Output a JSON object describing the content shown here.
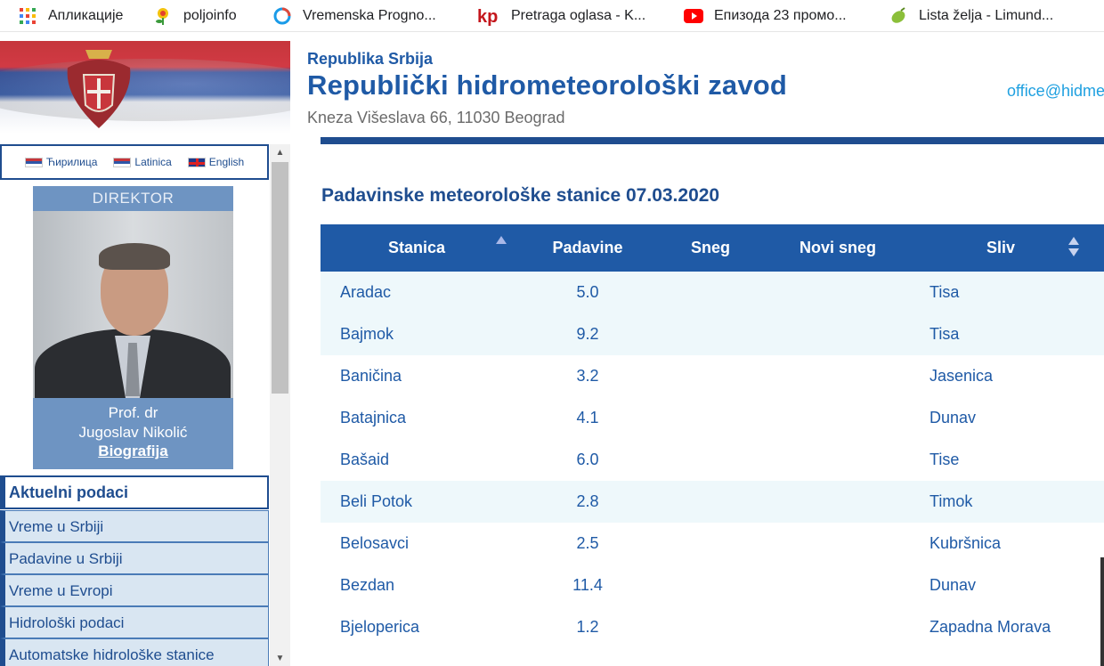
{
  "bookmarks": [
    {
      "label": "Апликације",
      "icon": "apps-grid-icon"
    },
    {
      "label": "poljoinfo",
      "icon": "flower-icon"
    },
    {
      "label": "Vremenska Progno...",
      "icon": "ring-icon"
    },
    {
      "label": "Pretraga oglasa - K...",
      "icon": "kp-logo-icon"
    },
    {
      "label": "Епизода 23 промо...",
      "icon": "youtube-icon"
    },
    {
      "label": "Lista želja - Limund...",
      "icon": "leaf-icon"
    }
  ],
  "header": {
    "org_small": "Republika Srbija",
    "org_big": "Republički hidrometeorološki zavod",
    "address": "Kneza Višeslava 66, 11030 Beograd",
    "email": "office@hidmet.gov.rs"
  },
  "sidebar": {
    "languages": [
      "Ћирилица",
      "Latinica",
      "English"
    ],
    "director_title": "DIREKTOR",
    "director_name_1": "Prof. dr",
    "director_name_2": "Jugoslav Nikolić",
    "director_link": "Biografija",
    "menu_head": "Aktuelni podaci",
    "menu_items": [
      "Vreme u Srbiji",
      "Padavine u Srbiji",
      "Vreme u Evropi",
      "Hidrološki podaci",
      "Automatske hidrološke stanice"
    ]
  },
  "main": {
    "title": "Padavinske meteorološke stanice 07.03.2020",
    "columns": [
      "Stanica",
      "Padavine",
      "Sneg",
      "Novi sneg",
      "Sliv"
    ],
    "rows": [
      {
        "stanica": "Aradac",
        "padavine": "5.0",
        "sliv": "Tisa"
      },
      {
        "stanica": "Bajmok",
        "padavine": "9.2",
        "sliv": "Tisa"
      },
      {
        "stanica": "Baničina",
        "padavine": "3.2",
        "sliv": "Jasenica"
      },
      {
        "stanica": "Batajnica",
        "padavine": "4.1",
        "sliv": "Dunav"
      },
      {
        "stanica": "Bašaid",
        "padavine": "6.0",
        "sliv": "Tise"
      },
      {
        "stanica": "Beli Potok",
        "padavine": "2.8",
        "sliv": "Timok"
      },
      {
        "stanica": "Belosavci",
        "padavine": "2.5",
        "sliv": "Kubršnica"
      },
      {
        "stanica": "Bezdan",
        "padavine": "11.4",
        "sliv": "Dunav"
      },
      {
        "stanica": "Bjeloperica",
        "padavine": "1.2",
        "sliv": "Zapadna Morava"
      }
    ]
  },
  "colors": {
    "brand_blue": "#1f5aa6",
    "dark_blue": "#1f4d8f",
    "row_alt": "#eef8fb",
    "menu_bg": "#d9e6f2",
    "email": "#1fa0e0"
  }
}
